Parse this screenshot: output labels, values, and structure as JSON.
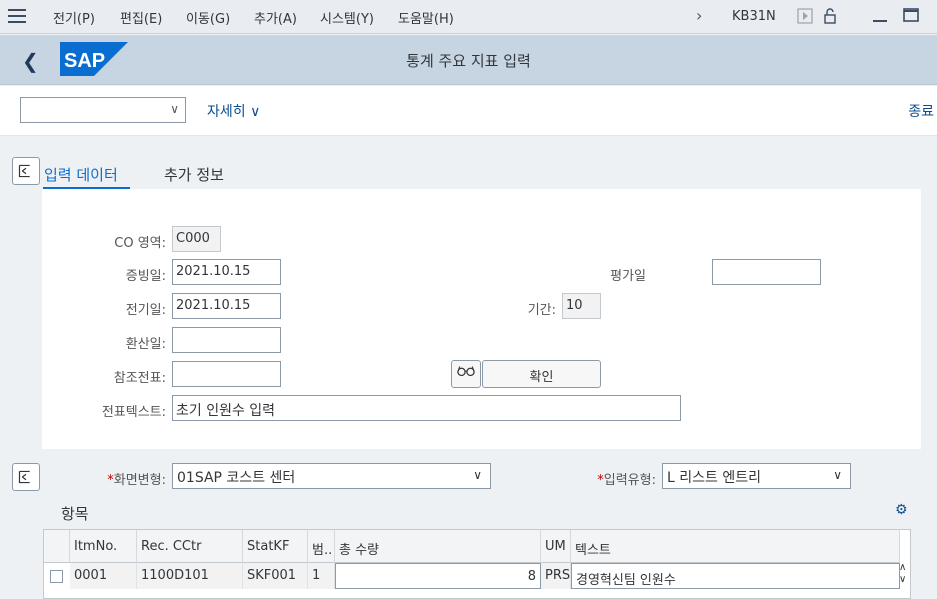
{
  "menu": {
    "items": [
      "전기(P)",
      "편집(E)",
      "이동(G)",
      "추가(A)",
      "시스템(Y)",
      "도움말(H)"
    ],
    "tcode": "KB31N"
  },
  "title": {
    "text": "통계 주요 지표 입력",
    "logo": "SAP"
  },
  "toolbar": {
    "variant_value": "",
    "more_label": "자세히",
    "exit_label": "종료"
  },
  "tabs": {
    "input_data": "입력 데이터",
    "additional_info": "추가 정보"
  },
  "header": {
    "co_area_label": "CO 영역:",
    "co_area_value": "C000",
    "doc_date_label": "증빙일:",
    "doc_date_value": "2021.10.15",
    "posting_date_label": "전기일:",
    "posting_date_value": "2021.10.15",
    "translation_date_label": "환산일:",
    "translation_date_value": "",
    "ref_doc_label": "참조전표:",
    "ref_doc_value": "",
    "doc_text_label": "전표텍스트:",
    "doc_text_value": "초기 인원수 입력",
    "value_date_label": "평가일",
    "value_date_value": "",
    "period_label": "기간:",
    "period_value": "10",
    "confirm_label": "확인"
  },
  "entry": {
    "screen_variant_label": "화면변형:",
    "screen_variant_value": "01SAP 코스트 센터",
    "input_type_label": "입력유형:",
    "input_type_value": "L 리스트 엔트리"
  },
  "items": {
    "title": "항목",
    "columns": [
      "ItmNo.",
      "Rec. CCtr",
      "StatKF",
      "범..",
      "총 수량",
      "UM",
      "텍스트"
    ],
    "rows": [
      {
        "itm": "0001",
        "cctr": "1100D101",
        "statkf": "SKF001",
        "cat": "1",
        "qty": "8",
        "um": "PRS",
        "text": "경영혁신팀 인원수"
      }
    ]
  },
  "colors": {
    "accent": "#0a6ed1",
    "title_bar": "#c7d5e3",
    "menu_bar": "#e9edf1",
    "sap_blue": "#0a6ed1"
  }
}
